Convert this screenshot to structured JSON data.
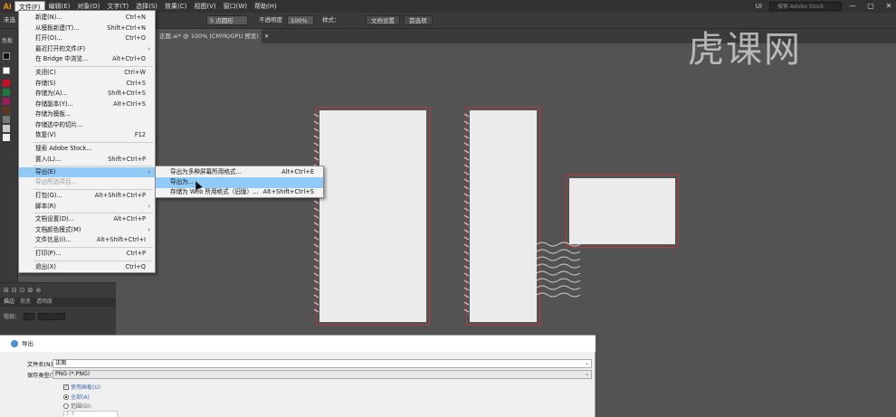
{
  "app": {
    "logo": "Ai"
  },
  "menubar": {
    "items": [
      "文件(F)",
      "编辑(E)",
      "对象(O)",
      "文字(T)",
      "选择(S)",
      "效果(C)",
      "视图(V)",
      "窗口(W)",
      "帮助(H)"
    ],
    "workspace": "UI",
    "search_placeholder": "搜索 Adobe Stock",
    "window_buttons": [
      "—",
      "▢",
      "✕"
    ]
  },
  "controlbar": {
    "left_text": "未选",
    "stroke_weight": "5 点圆形",
    "opacity_label": "不透明度",
    "opacity_value": "100%",
    "style_label": "样式：",
    "doc_setup": "文档设置",
    "preferences": "首选项"
  },
  "swatch_panel": {
    "title": "色板"
  },
  "document": {
    "tab_title": "正面.ai* @ 100% (CMYK/GPU 预览)",
    "tab_close": "✕"
  },
  "file_menu": {
    "items": [
      {
        "label": "新建(N)...",
        "shortcut": "Ctrl+N"
      },
      {
        "label": "从模板新建(T)...",
        "shortcut": "Shift+Ctrl+N"
      },
      {
        "label": "打开(O)...",
        "shortcut": "Ctrl+O"
      },
      {
        "label": "最近打开的文件(F)",
        "shortcut": "",
        "submenu": true
      },
      {
        "label": "在 Bridge 中浏览...",
        "shortcut": "Alt+Ctrl+O"
      },
      {
        "label": "关闭(C)",
        "shortcut": "Ctrl+W"
      },
      {
        "label": "存储(S)",
        "shortcut": "Ctrl+S"
      },
      {
        "label": "存储为(A)...",
        "shortcut": "Shift+Ctrl+S"
      },
      {
        "label": "存储副本(Y)...",
        "shortcut": "Alt+Ctrl+S"
      },
      {
        "label": "存储为模板...",
        "shortcut": ""
      },
      {
        "label": "存储选中的切片...",
        "shortcut": ""
      },
      {
        "label": "恢复(V)",
        "shortcut": "F12"
      },
      {
        "label": "搜索 Adobe Stock...",
        "shortcut": ""
      },
      {
        "label": "置入(L)...",
        "shortcut": "Shift+Ctrl+P"
      },
      {
        "label": "导出(E)",
        "shortcut": "",
        "submenu": true
      },
      {
        "label": "导出所选项目...",
        "shortcut": ""
      },
      {
        "label": "打包(G)...",
        "shortcut": "Alt+Shift+Ctrl+P"
      },
      {
        "label": "脚本(R)",
        "shortcut": "",
        "submenu": true
      },
      {
        "label": "文档设置(D)...",
        "shortcut": "Alt+Ctrl+P"
      },
      {
        "label": "文档颜色模式(M)",
        "shortcut": "",
        "submenu": true
      },
      {
        "label": "文件信息(I)...",
        "shortcut": "Alt+Shift+Ctrl+I"
      },
      {
        "label": "打印(P)...",
        "shortcut": "Ctrl+P"
      },
      {
        "label": "退出(X)",
        "shortcut": "Ctrl+Q"
      }
    ]
  },
  "export_submenu": {
    "items": [
      {
        "label": "导出为多种屏幕所用格式...",
        "shortcut": "Alt+Ctrl+E"
      },
      {
        "label": "导出为...",
        "shortcut": ""
      },
      {
        "label": "存储为 Web 所用格式（旧版）...",
        "shortcut": "Alt+Shift+Ctrl+S"
      }
    ]
  },
  "left_panel": {
    "tabs": [
      "描边",
      "渐变",
      "透明度"
    ],
    "stroke_label": "粗细："
  },
  "save_dialog": {
    "title": "导出",
    "filename_label": "文件名(N):",
    "filename_value": "正面",
    "type_label": "保存类型(T):",
    "type_value": "PNG (*.PNG)",
    "use_artboards": "使用画板(U)",
    "all": "全部(A)",
    "range": "范围(G):",
    "range_value": "1-3"
  },
  "watermark": "虎课网"
}
